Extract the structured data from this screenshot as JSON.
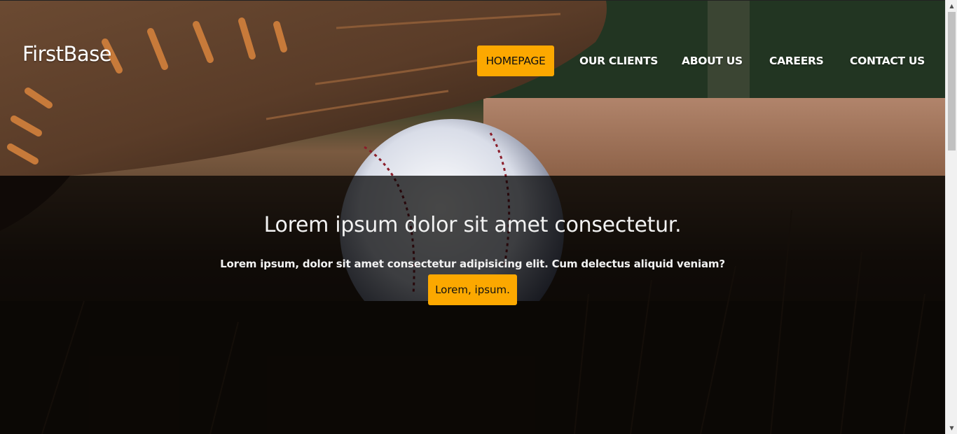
{
  "brand": {
    "logo_text": "FirstBase"
  },
  "nav": {
    "items": [
      {
        "label": "HOMEPAGE",
        "active": true
      },
      {
        "label": "OUR CLIENTS",
        "active": false
      },
      {
        "label": "ABOUT US",
        "active": false
      },
      {
        "label": "CAREERS",
        "active": false
      },
      {
        "label": "CONTACT US",
        "active": false
      }
    ]
  },
  "hero": {
    "headline": "Lorem ipsum dolor sit amet consectetur.",
    "subtext": "Lorem ipsum, dolor sit amet consectetur adipisicing elit. Cum delectus aliquid veniam?",
    "cta_label": "Lorem, ipsum."
  },
  "colors": {
    "accent": "#fca800",
    "text_light": "#ffffff",
    "overlay": "#000000"
  },
  "icons": {
    "scroll_up": "triangle-up-icon",
    "scroll_down": "triangle-down-icon"
  }
}
